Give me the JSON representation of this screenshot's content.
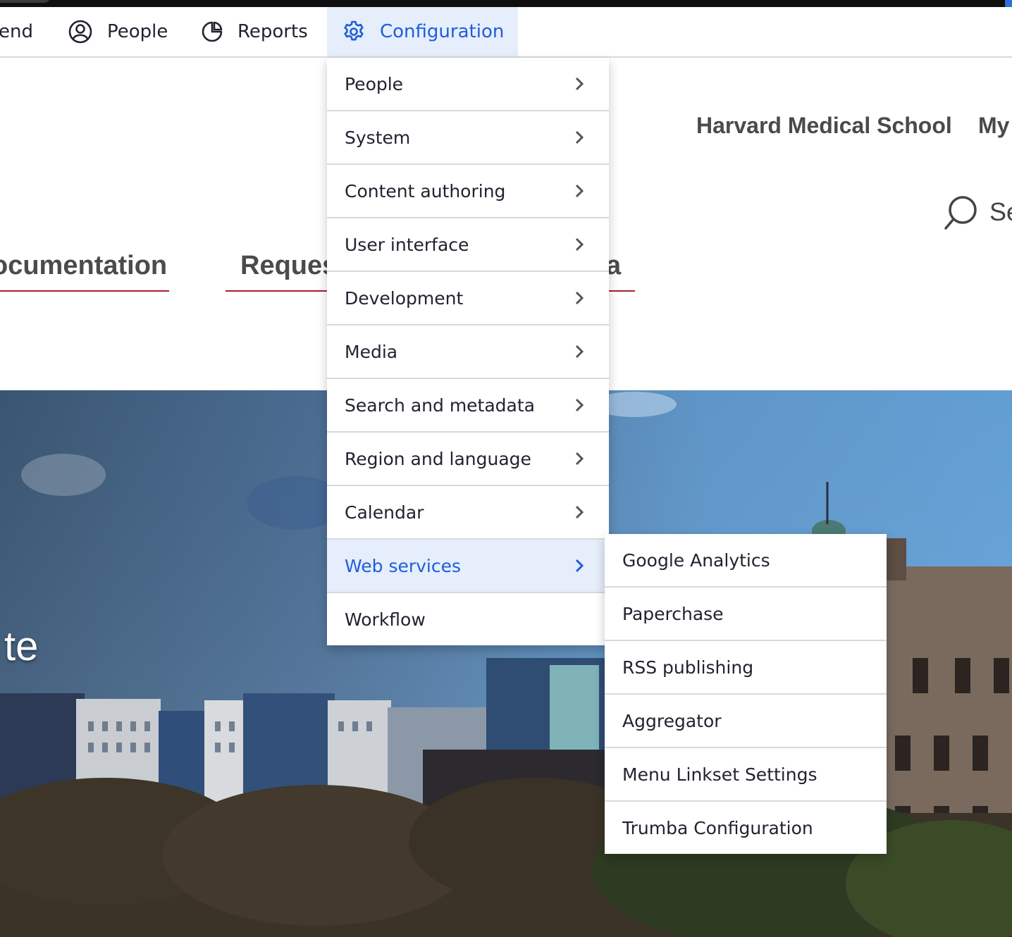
{
  "toolbar": {
    "items": [
      {
        "label": "end",
        "icon": "none"
      },
      {
        "label": "People",
        "icon": "user-circle-icon"
      },
      {
        "label": "Reports",
        "icon": "pie-chart-icon"
      },
      {
        "label": "Configuration",
        "icon": "gear-icon",
        "active": true
      }
    ]
  },
  "site": {
    "org_link": "Harvard Medical School",
    "my_link": "My",
    "search_label": "Se",
    "nav_tabs": [
      "ocumentation",
      "Reques",
      "a"
    ],
    "hero_text": "te"
  },
  "config_menu": {
    "items": [
      {
        "label": "People"
      },
      {
        "label": "System"
      },
      {
        "label": "Content authoring"
      },
      {
        "label": "User interface"
      },
      {
        "label": "Development"
      },
      {
        "label": "Media"
      },
      {
        "label": "Search and metadata"
      },
      {
        "label": "Region and language"
      },
      {
        "label": "Calendar"
      },
      {
        "label": "Web services",
        "active": true
      },
      {
        "label": "Workflow"
      }
    ]
  },
  "web_services_submenu": {
    "items": [
      {
        "label": "Google Analytics"
      },
      {
        "label": "Paperchase"
      },
      {
        "label": "RSS publishing"
      },
      {
        "label": "Aggregator"
      },
      {
        "label": "Menu Linkset Settings"
      },
      {
        "label": "Trumba Configuration"
      }
    ]
  },
  "colors": {
    "accent": "#1f5fd6",
    "active_bg": "#e6edfb",
    "crimson": "#a51c30",
    "text": "#222330"
  }
}
